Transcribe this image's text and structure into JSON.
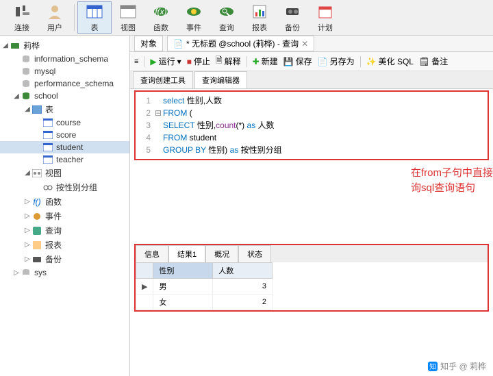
{
  "toolbar": [
    {
      "name": "connect",
      "label": "连接",
      "icon": "plug"
    },
    {
      "name": "user",
      "label": "用户",
      "icon": "user"
    },
    {
      "name": "sep"
    },
    {
      "name": "table",
      "label": "表",
      "icon": "table",
      "active": true
    },
    {
      "name": "view",
      "label": "视图",
      "icon": "view"
    },
    {
      "name": "function",
      "label": "函数",
      "icon": "fx"
    },
    {
      "name": "event",
      "label": "事件",
      "icon": "event"
    },
    {
      "name": "query",
      "label": "查询",
      "icon": "query"
    },
    {
      "name": "report",
      "label": "报表",
      "icon": "report"
    },
    {
      "name": "backup",
      "label": "备份",
      "icon": "backup"
    },
    {
      "name": "schedule",
      "label": "计划",
      "icon": "sched"
    }
  ],
  "tree": {
    "root": "莉桦",
    "dbs": [
      "information_schema",
      "mysql",
      "performance_schema"
    ],
    "school": {
      "name": "school",
      "tables_label": "表",
      "tables": [
        "course",
        "score",
        "student",
        "teacher"
      ],
      "views_label": "视图",
      "views": [
        "按性别分组"
      ],
      "fx_label": "函数",
      "event_label": "事件",
      "query_label": "查询",
      "report_label": "报表",
      "backup_label": "备份"
    },
    "sys": "sys"
  },
  "tabs": {
    "object": "对象",
    "querytab": "* 无标题 @school (莉桦) - 查询"
  },
  "actions": {
    "run": "运行",
    "stop": "停止",
    "explain": "解释",
    "new": "新建",
    "save": "保存",
    "saveas": "另存为",
    "beautify": "美化 SQL",
    "backup": "备注"
  },
  "subtabs": {
    "builder": "查询创建工具",
    "editor": "查询编辑器"
  },
  "sql": [
    {
      "n": "1",
      "fold": "",
      "txt": [
        {
          "t": "kw",
          "v": "select"
        },
        {
          "t": "sp",
          "v": " "
        },
        {
          "t": "id",
          "v": "性别,人数"
        }
      ]
    },
    {
      "n": "2",
      "fold": "⊟",
      "txt": [
        {
          "t": "kw",
          "v": "FROM"
        },
        {
          "t": "sp",
          "v": " ("
        }
      ]
    },
    {
      "n": "3",
      "fold": "",
      "txt": [
        {
          "t": "kw",
          "v": "SELECT"
        },
        {
          "t": "sp",
          "v": " "
        },
        {
          "t": "id",
          "v": "性别,"
        },
        {
          "t": "fn",
          "v": "count"
        },
        {
          "t": "sp",
          "v": "(*) "
        },
        {
          "t": "kw",
          "v": "as"
        },
        {
          "t": "sp",
          "v": " "
        },
        {
          "t": "id",
          "v": "人数"
        }
      ]
    },
    {
      "n": "4",
      "fold": "",
      "txt": [
        {
          "t": "kw",
          "v": "FROM"
        },
        {
          "t": "sp",
          "v": " student"
        }
      ]
    },
    {
      "n": "5",
      "fold": "",
      "txt": [
        {
          "t": "kw",
          "v": "GROUP BY"
        },
        {
          "t": "sp",
          "v": " 性别) "
        },
        {
          "t": "kw",
          "v": "as"
        },
        {
          "t": "sp",
          "v": " "
        },
        {
          "t": "id",
          "v": "按性别分组"
        }
      ]
    }
  ],
  "annotation": "在from子句中直接定义视图的查询sql查询语句",
  "result": {
    "tabs": [
      "信息",
      "结果1",
      "概况",
      "状态"
    ],
    "active_tab": 1,
    "headers": [
      "性别",
      "人数"
    ],
    "rows": [
      {
        "ptr": "▶",
        "c1": "男",
        "c2": "3"
      },
      {
        "ptr": "",
        "c1": "女",
        "c2": "2"
      }
    ]
  },
  "watermark": "知乎 @ 莉桦",
  "chart_data": {
    "type": "table",
    "title": "结果1",
    "headers": [
      "性别",
      "人数"
    ],
    "rows": [
      [
        "男",
        3
      ],
      [
        "女",
        2
      ]
    ]
  }
}
